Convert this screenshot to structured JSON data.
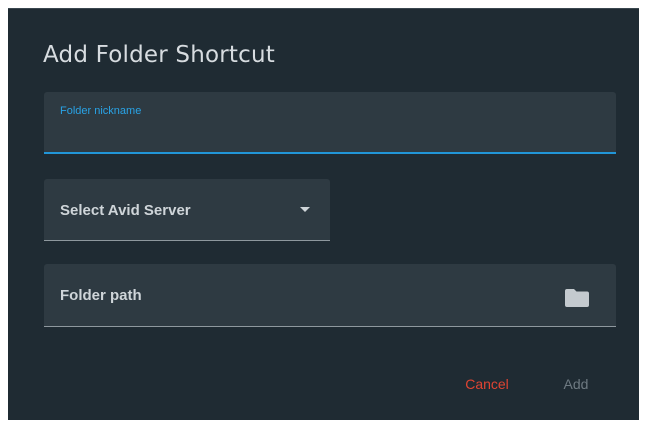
{
  "dialog": {
    "title": "Add Folder Shortcut",
    "colors": {
      "background": "#1f2b33",
      "field_background": "#2e3a42",
      "focus_accent": "#2196d8",
      "cancel_color": "#e04432",
      "disabled_color": "#6e7a82"
    }
  },
  "form": {
    "nickname": {
      "label": "Folder nickname",
      "value": "",
      "focused": true
    },
    "server_select": {
      "selected_label": "Select Avid Server",
      "icon": "dropdown-arrow-icon"
    },
    "folder_path": {
      "label": "Folder path",
      "icon": "folder-icon"
    }
  },
  "actions": {
    "cancel_label": "Cancel",
    "add_label": "Add"
  }
}
